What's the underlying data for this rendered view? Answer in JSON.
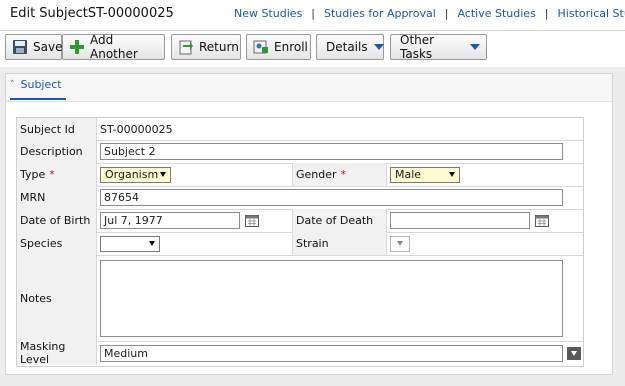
{
  "header": {
    "title": "Edit SubjectST-00000025",
    "nav": [
      "New Studies",
      "Studies for Approval",
      "Active Studies",
      "Historical Stud"
    ]
  },
  "toolbar": {
    "save": "Save",
    "add_another": "Add Another",
    "return": "Return",
    "enroll": "Enroll",
    "details": "Details",
    "other_tasks": "Other Tasks"
  },
  "panel": {
    "tab": "Subject"
  },
  "form": {
    "subject_id": {
      "label": "Subject Id",
      "value": "ST-00000025"
    },
    "description": {
      "label": "Description",
      "value": "Subject 2"
    },
    "type": {
      "label": "Type",
      "required": "*",
      "value": "Organism"
    },
    "gender": {
      "label": "Gender",
      "required": "*",
      "value": "Male"
    },
    "mrn": {
      "label": "MRN",
      "value": "87654"
    },
    "dob": {
      "label": "Date of Birth",
      "value": "Jul 7, 1977"
    },
    "dod": {
      "label": "Date of Death",
      "value": ""
    },
    "species": {
      "label": "Species",
      "value": ""
    },
    "strain": {
      "label": "Strain",
      "value": ""
    },
    "notes": {
      "label": "Notes",
      "value": ""
    },
    "masking": {
      "label": "Masking Level",
      "value": "Medium"
    }
  },
  "colors": {
    "link": "#1a5aa6",
    "required": "#c0141e",
    "select_highlight": "#fdfbd1",
    "label_bg": "#f1f1f1"
  },
  "icons": [
    "save-icon",
    "add-icon",
    "return-icon",
    "enroll-icon",
    "calendar-icon",
    "chevron-up-icon",
    "dropdown-caret-icon"
  ]
}
